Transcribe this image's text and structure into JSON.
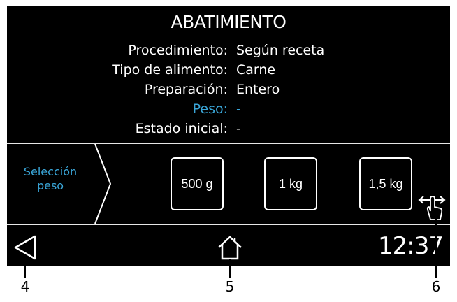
{
  "screen": {
    "title": "ABATIMIENTO",
    "info_rows": [
      {
        "label": "Procedimiento:",
        "value": "Según receta"
      },
      {
        "label": "Tipo de alimento:",
        "value": "Carne"
      },
      {
        "label": "Preparación:",
        "value": "Entero"
      },
      {
        "label": "Peso:",
        "value": "-"
      },
      {
        "label": "Estado inicial:",
        "value": "-"
      }
    ],
    "selector": {
      "label_line1": "Selección",
      "label_line2": "peso"
    },
    "weight_options": [
      "500 g",
      "1 kg",
      "1,5 kg"
    ],
    "icons": {
      "chevron": "chevron-right-icon",
      "swipe": "swipe-hand-icon",
      "back": "back-triangle-icon",
      "home": "home-icon"
    },
    "colors": {
      "accent": "#3aa6d8",
      "background": "#000000",
      "foreground": "#ffffff"
    },
    "clock": "12:37"
  },
  "callouts": [
    "4",
    "5",
    "6"
  ]
}
